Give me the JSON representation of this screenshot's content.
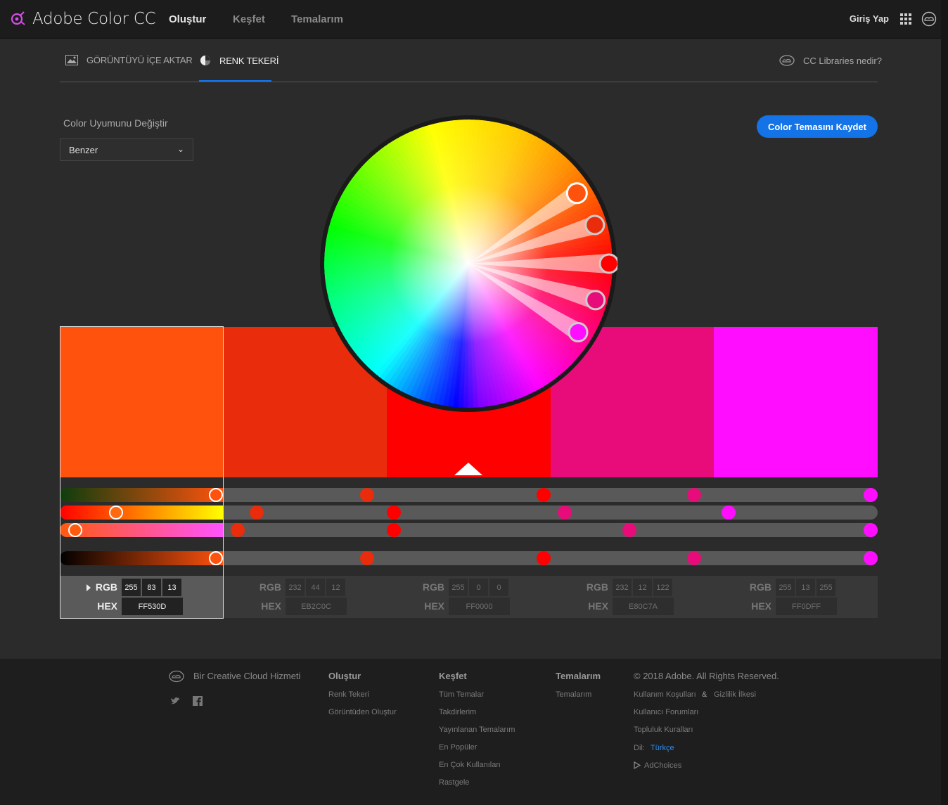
{
  "app": {
    "title": "Adobe Color CC"
  },
  "nav": {
    "links": [
      {
        "label": "Oluştur",
        "active": true
      },
      {
        "label": "Keşfet",
        "active": false
      },
      {
        "label": "Temalarım",
        "active": false
      }
    ],
    "login_label": "Giriş Yap",
    "apps_icon": "grid-icon",
    "cc_icon": "creative-cloud-icon"
  },
  "subtabs": {
    "import_label": "GÖRÜNTÜYÜ İÇE AKTAR",
    "wheel_label": "RENK TEKERİ",
    "active": "RENK TEKERİ",
    "cc_libraries_label": "CC Libraries nedir?"
  },
  "harmony": {
    "label": "Color Uyumunu Değiştir",
    "selected": "Benzer"
  },
  "save_button": "Color Temasını Kaydet",
  "accent_color": "#1473e6",
  "theme": {
    "selected_index": 0,
    "base_index": 2,
    "mode_labels": {
      "rgb": "RGB",
      "hex": "HEX"
    },
    "swatches": [
      {
        "hex": "FF530D",
        "rgb": [
          "255",
          "83",
          "13"
        ],
        "color": "#FF530D"
      },
      {
        "hex": "EB2C0C",
        "rgb": [
          "232",
          "44",
          "12"
        ],
        "color": "#E82C0C"
      },
      {
        "hex": "FF0000",
        "rgb": [
          "255",
          "0",
          "0"
        ],
        "color": "#FF0000"
      },
      {
        "hex": "E80C7A",
        "rgb": [
          "232",
          "12",
          "122"
        ],
        "color": "#E80C7A"
      },
      {
        "hex": "FF0DFF",
        "rgb": [
          "255",
          "13",
          "255"
        ],
        "color": "#FF0DFF"
      }
    ]
  },
  "footer": {
    "cc_service": "Bir Creative Cloud Hizmeti",
    "social_icons": [
      "twitter-icon",
      "facebook-icon"
    ],
    "columns": [
      {
        "heading": "Oluştur",
        "links": [
          "Renk Tekeri",
          "Görüntüden Oluştur"
        ]
      },
      {
        "heading": "Keşfet",
        "links": [
          "Tüm Temalar",
          "Takdirlerim",
          "Yayınlanan Temalarım",
          "En Popüler",
          "En Çok Kullanılan",
          "Rastgele"
        ]
      },
      {
        "heading": "Temalarım",
        "links": [
          "Temalarım"
        ]
      }
    ],
    "copyright": "© 2018 Adobe. All Rights Reserved.",
    "terms": "Kullanım Koşulları",
    "ampersand": "&",
    "privacy": "Gizlilik İlkesi",
    "forums": "Kullanıcı Forumları",
    "community": "Topluluk Kuralları",
    "language_label": "Dil:",
    "language_value": "Türkçe",
    "adchoices": "AdChoices"
  }
}
